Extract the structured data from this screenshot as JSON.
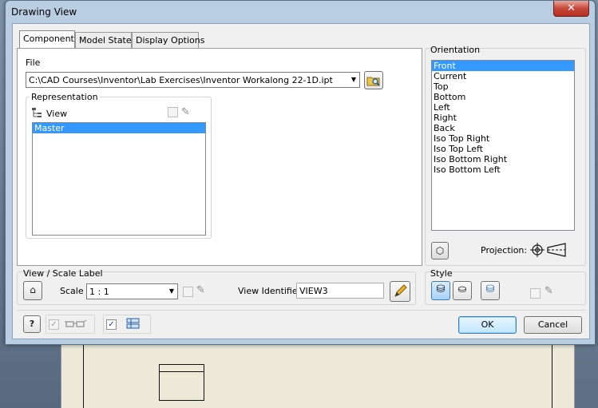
{
  "dialog": {
    "title": "Drawing View",
    "close_label": "✕"
  },
  "tabs": [
    {
      "label": "Component",
      "active": true
    },
    {
      "label": "Model State",
      "active": false
    },
    {
      "label": "Display Options",
      "active": false
    }
  ],
  "component": {
    "file_label": "File",
    "file_value": "C:\\CAD Courses\\Inventor\\Lab Exercises\\Inventor Workalong 22-1D.ipt",
    "representation_label": "Representation",
    "view_label": "View",
    "rep_items": [
      "Master"
    ],
    "rep_selected": "Master"
  },
  "orientation": {
    "label": "Orientation",
    "items": [
      "Front",
      "Current",
      "Top",
      "Bottom",
      "Left",
      "Right",
      "Back",
      "Iso Top Right",
      "Iso Top Left",
      "Iso Bottom Right",
      "Iso Bottom Left"
    ],
    "selected": "Front",
    "projection_label": "Projection:"
  },
  "view_scale": {
    "label": "View / Scale Label",
    "scale_label": "Scale",
    "scale_value": "1 : 1",
    "view_identifier_label": "View Identifier",
    "view_identifier_value": "VIEW3"
  },
  "style": {
    "label": "Style"
  },
  "buttons": {
    "ok": "OK",
    "cancel": "Cancel"
  },
  "colors": {
    "selection": "#3399ff",
    "dialog_frame": "#b9cde3",
    "close_button": "#c7473a"
  }
}
